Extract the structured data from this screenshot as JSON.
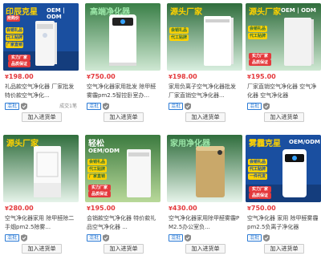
{
  "currency_symbol": "¥",
  "add_button_label": "加入进货单",
  "badge_label": "混批",
  "products": [
    {
      "price": "198.00",
      "title": "礼品款空气净化器 厂家批发特价款空气净化...",
      "sales": "成交1笔",
      "img": {
        "headline": "印辰克星",
        "sub": "OEM | ODM",
        "tag": "抢购价",
        "side1": "会销礼品",
        "side2": "代工贴牌",
        "side3": "广家直销",
        "bottom": "实力厂家",
        "bottom2": "品质保证",
        "bg": "#1a4fa0",
        "accent": "#ffd200"
      }
    },
    {
      "price": "750.00",
      "title": "空气净化器家用批发 除甲醛雾霾pm2.5智控卧室办...",
      "sales": "",
      "img": {
        "headline": "高端净化器",
        "sub": "",
        "bg": "#2f6d3c",
        "accent": "#9be6a8"
      }
    },
    {
      "price": "198.00",
      "title": "家用负离子空气净化器批发 厂家直销空气净化器...",
      "sales": "",
      "img": {
        "headline": "源头厂家",
        "sub": "",
        "side1": "会销礼品",
        "side2": "代工贴牌",
        "bg": "#2f6d3c",
        "accent": "#ffd200"
      }
    },
    {
      "price": "195.00",
      "title": "厂家直销空气净化器 空气净化器 空气净化器",
      "sales": "",
      "img": {
        "headline": "源头厂家",
        "sub": "OEM | ODM",
        "side1": "会销礼品",
        "side2": "代工贴牌",
        "bottom": "实力厂家",
        "bottom2": "品质保证",
        "bg": "#2f6d3c",
        "accent": "#ffd200"
      }
    },
    {
      "price": "280.00",
      "title": "空气净化器家用 除甲醛除二手烟pm2.5除雾...",
      "sales": "",
      "img": {
        "headline": "源头厂家",
        "sub": "",
        "bg": "#2f6d3c",
        "accent": "#ffd200"
      }
    },
    {
      "price": "195.00",
      "title": "会销款空气净化器 特价款礼品空气净化器 ...",
      "sales": "",
      "img": {
        "headline": "轻松",
        "sub": "OEM/ODM",
        "side1": "会销礼品",
        "side2": "代工贴牌",
        "side3": "厂家直销",
        "bottom": "实力厂家",
        "bottom2": "品质保证",
        "bg": "#2f6d3c",
        "accent": "#ffd200"
      }
    },
    {
      "price": "430.00",
      "title": "空气净化器家用除甲醛雾霾PM2.5办公室负...",
      "sales": "",
      "img": {
        "headline": "家用净化器",
        "sub": "",
        "bg": "#2f6d3c",
        "accent": "#9be6a8"
      }
    },
    {
      "price": "750.00",
      "title": "空气净化器 家用 除甲醛雾霾pm2.5负离子净化器",
      "sales": "",
      "img": {
        "headline": "雾霾克星",
        "sub": "OEM/ODM",
        "side1": "会销礼品",
        "side2": "代工贴牌",
        "side3": "一件代发",
        "bottom": "实力厂家",
        "bottom2": "品质保证",
        "bg": "#1a4fa0",
        "accent": "#ffd200"
      }
    }
  ]
}
